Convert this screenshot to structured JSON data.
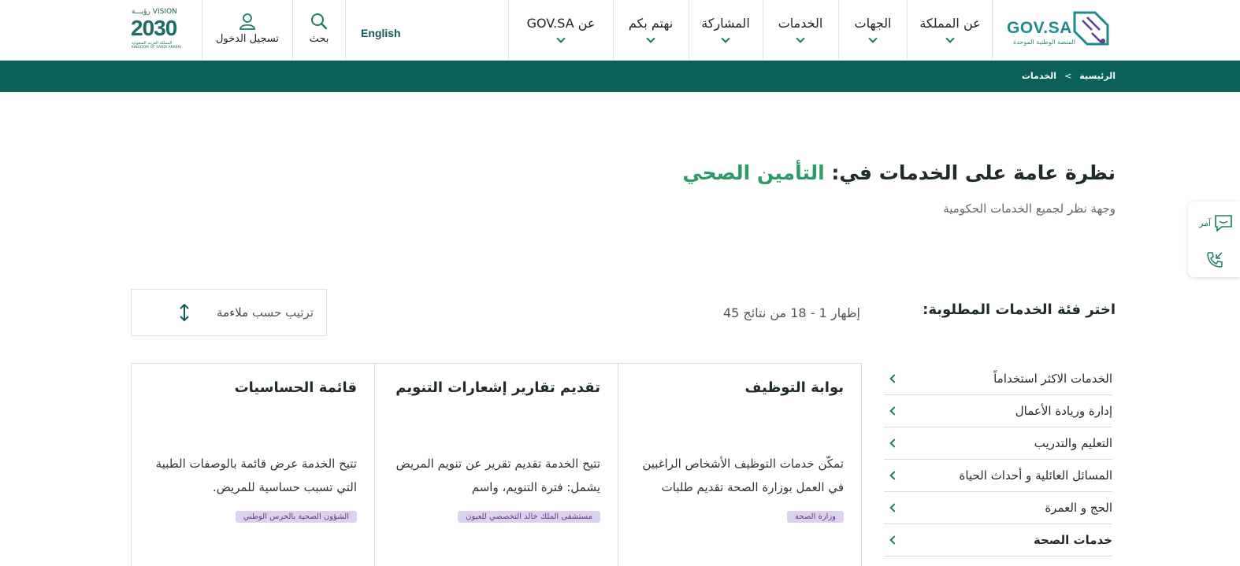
{
  "header": {
    "logo_text": "GOV.SA",
    "logo_subtitle": "المنصة الوطنية الموحدة",
    "nav": [
      {
        "id": "about-kingdom",
        "label": "عن المملكة"
      },
      {
        "id": "agencies",
        "label": "الجهات"
      },
      {
        "id": "services",
        "label": "الخدمات"
      },
      {
        "id": "participation",
        "label": "المشاركة"
      },
      {
        "id": "we-care",
        "label": "نهتم بكم"
      },
      {
        "id": "about-govsa",
        "label": "عن GOV.SA"
      }
    ],
    "language": "English",
    "search_label": "بحث",
    "login_label": "تسجيل الدخول",
    "vision": {
      "top": "VISION رؤيـــة",
      "number": "2030",
      "ar": "المملكة العربية السعودية",
      "en": "KINGDOM OF SAUDI ARABIA"
    }
  },
  "breadcrumb": {
    "home": "الرئيسية",
    "separator": ">",
    "current": "الخدمات"
  },
  "page": {
    "title_prefix": "نظرة عامة على الخدمات في:",
    "title_highlight": "التأمين الصحي",
    "subtitle": "وجهة نظر لجميع الخدمات الحكومية"
  },
  "float_widget": {
    "amr_label": "آمر"
  },
  "filters": {
    "category_heading": "اختر فئة الخدمات المطلوبة:",
    "results_text": "إظهار 1 - 18 من نتائج 45",
    "sort_label": "ترتيب حسب",
    "sort_value": "ملاءمة"
  },
  "categories": [
    {
      "label": "الخدمات الاكثر استخداماً",
      "active": false
    },
    {
      "label": "إدارة وريادة الأعمال",
      "active": false
    },
    {
      "label": "التعليم والتدريب",
      "active": false
    },
    {
      "label": "المسائل العائلية و أحداث الحياة",
      "active": false
    },
    {
      "label": "الحج و العمرة",
      "active": false
    },
    {
      "label": "خدمات الصحة",
      "active": true
    }
  ],
  "cards": [
    {
      "title": "بوابة التوظيف",
      "description": "تمكّن خدمات التوظيف الأشخاص الراغبين في العمل بوزارة الصحة تقديم طلبات",
      "tag": "وزارة الصحة"
    },
    {
      "title": "تقديم تقارير إشعارات التنويم",
      "description": "تتيح الخدمة تقديم تقرير عن تنويم المريض يشمل: فترة التنويم، واسم",
      "tag": "مستشفى الملك خالد التخصصي للعيون"
    },
    {
      "title": "قائمة الحساسيات",
      "description": "تتيح الخدمة عرض قائمة بالوصفات الطبية التي تسبب حساسية للمريض.",
      "tag": "الشؤون الصحية بالحرس الوطني"
    }
  ],
  "colors": {
    "brand": "#0b6157",
    "accent": "#2e9a6a",
    "tag_bg": "#ddd1f0"
  }
}
